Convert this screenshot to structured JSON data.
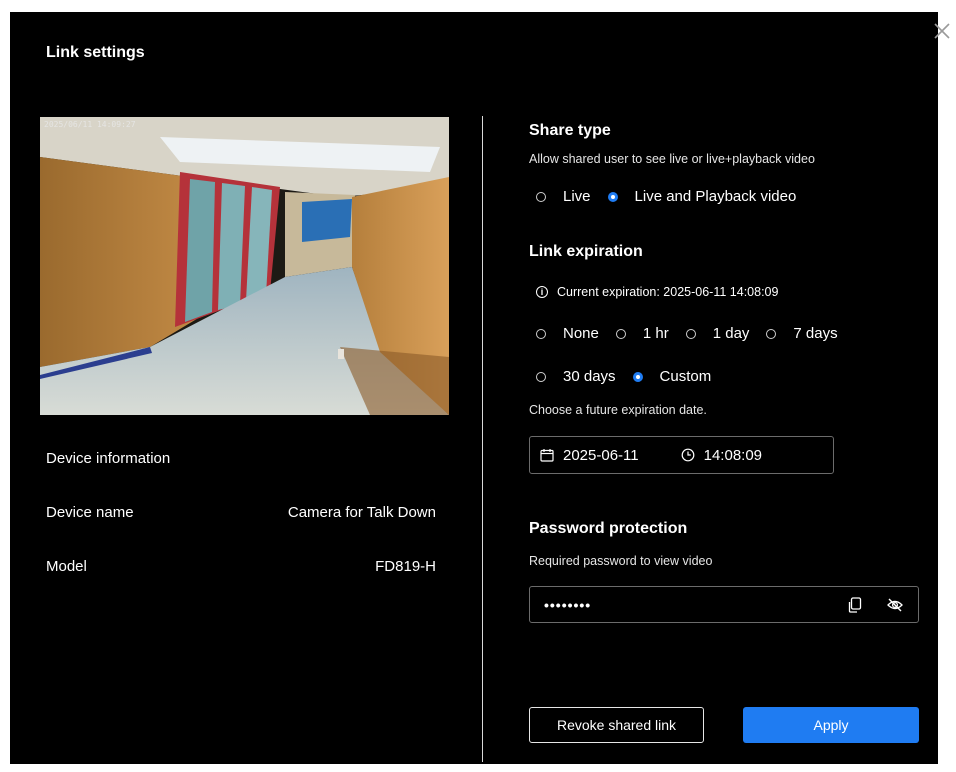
{
  "dialog": {
    "title": "Link settings",
    "close_icon": "close-icon"
  },
  "preview": {
    "osd_timestamp": "2025/06/11 14:09:27"
  },
  "device": {
    "section_label": "Device information",
    "name_label": "Device name",
    "name_value": "Camera for Talk Down",
    "model_label": "Model",
    "model_value": "FD819-H"
  },
  "share_type": {
    "title": "Share type",
    "description": "Allow shared user to see live or live+playback video",
    "options": [
      {
        "label": "Live",
        "selected": false
      },
      {
        "label": "Live and Playback video",
        "selected": true
      }
    ]
  },
  "link_expiration": {
    "title": "Link expiration",
    "current_expiration": "Current expiration: 2025-06-11 14:08:09",
    "options_row1": [
      {
        "label": "None",
        "selected": false
      },
      {
        "label": "1 hr",
        "selected": false
      },
      {
        "label": "1 day",
        "selected": false
      },
      {
        "label": "7 days",
        "selected": false
      }
    ],
    "options_row2": [
      {
        "label": "30 days",
        "selected": false
      },
      {
        "label": "Custom",
        "selected": true
      }
    ],
    "hint": "Choose a future expiration date.",
    "date_value": "2025-06-11",
    "time_value": "14:08:09"
  },
  "password": {
    "title": "Password protection",
    "description": "Required password to view video",
    "masked_value": "••••••••",
    "icons": [
      "copy-icon",
      "eye-off-icon"
    ]
  },
  "actions": {
    "revoke_label": "Revoke shared link",
    "apply_label": "Apply"
  },
  "colors": {
    "background": "#000000",
    "accent": "#1f7cf2",
    "border": "#6b6b6b"
  }
}
